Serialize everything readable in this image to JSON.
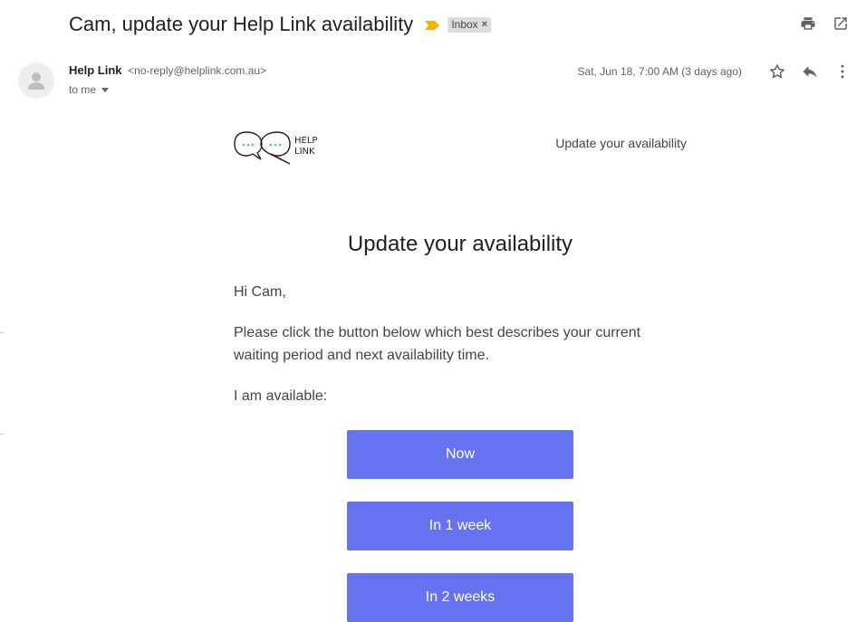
{
  "header": {
    "subject": "Cam, update your Help Link availability",
    "label": "Inbox",
    "label_remove": "×"
  },
  "actions": {
    "print_icon": "print-icon",
    "open_new_window_icon": "open-in-new-window-icon",
    "star_icon": "star-icon",
    "reply_icon": "reply-icon",
    "more_icon": "more-vertical-icon"
  },
  "message": {
    "sender_name": "Help Link",
    "sender_email": "<no-reply@helplink.com.au>",
    "recipient": "to me",
    "date": "Sat, Jun 18, 7:00 AM (3 days ago)"
  },
  "email": {
    "logo_text_line1": "HELP",
    "logo_text_line2": "LINK",
    "header_link": "Update your availability",
    "heading": "Update your availability",
    "greeting": "Hi Cam,",
    "body_line1": "Please click the button below which best describes your current",
    "body_line2": "waiting period and next availability time.",
    "prompt": "I am available:",
    "options": [
      "Now",
      "In 1 week",
      "In 2 weeks"
    ]
  },
  "colors": {
    "button": "#6673f0",
    "importance": "#f4b400",
    "logo_dots": "#3fc4d6"
  }
}
